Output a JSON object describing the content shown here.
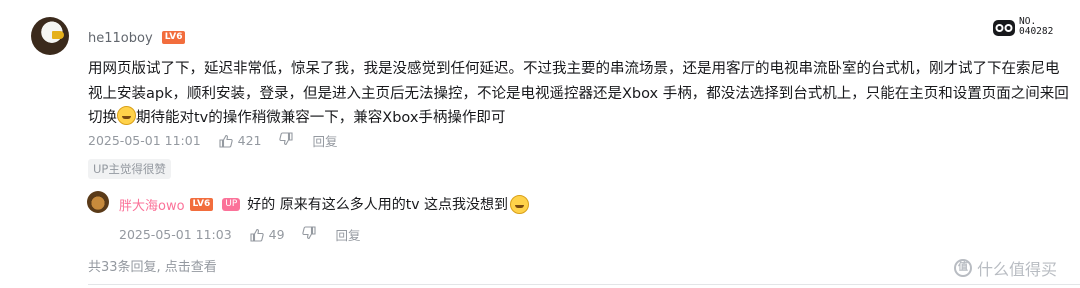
{
  "comment": {
    "username": "he11oboy",
    "level": "LV6",
    "badge_label": "NO.",
    "badge_number": "040282",
    "text_line1": "用网页版试了下，延迟非常低，惊呆了我，我是没感觉到任何延迟。不过我主要的串流场景，还是用客厅的电视串流卧室的台式机，刚才试了下在索尼电",
    "text_line2": "视上安装apk，顺利安装，登录，但是进入主页后无法操控，不论是电视遥控器还是Xbox 手柄，都没法选择到台式机上，只能在主页和设置页面之间来回",
    "text_line3_a": "切换",
    "text_line3_b": "期待能对tv的操作稍微兼容一下，兼容Xbox手柄操作即可",
    "time": "2025-05-01 11:01",
    "likes": "421",
    "reply_label": "回复",
    "tag": "UP主觉得很赞"
  },
  "reply": {
    "username": "胖大海owo",
    "level": "LV6",
    "up_label": "UP",
    "text": "好的 原来有这么多人用的tv 这点我没想到",
    "time": "2025-05-01 11:03",
    "likes": "49",
    "reply_label": "回复"
  },
  "more_replies": "共33条回复, 点击查看",
  "watermark": "什么值得买",
  "watermark_logo": "值",
  "icons": {
    "like": "thumbs-up-icon",
    "dislike": "thumbs-down-icon"
  }
}
